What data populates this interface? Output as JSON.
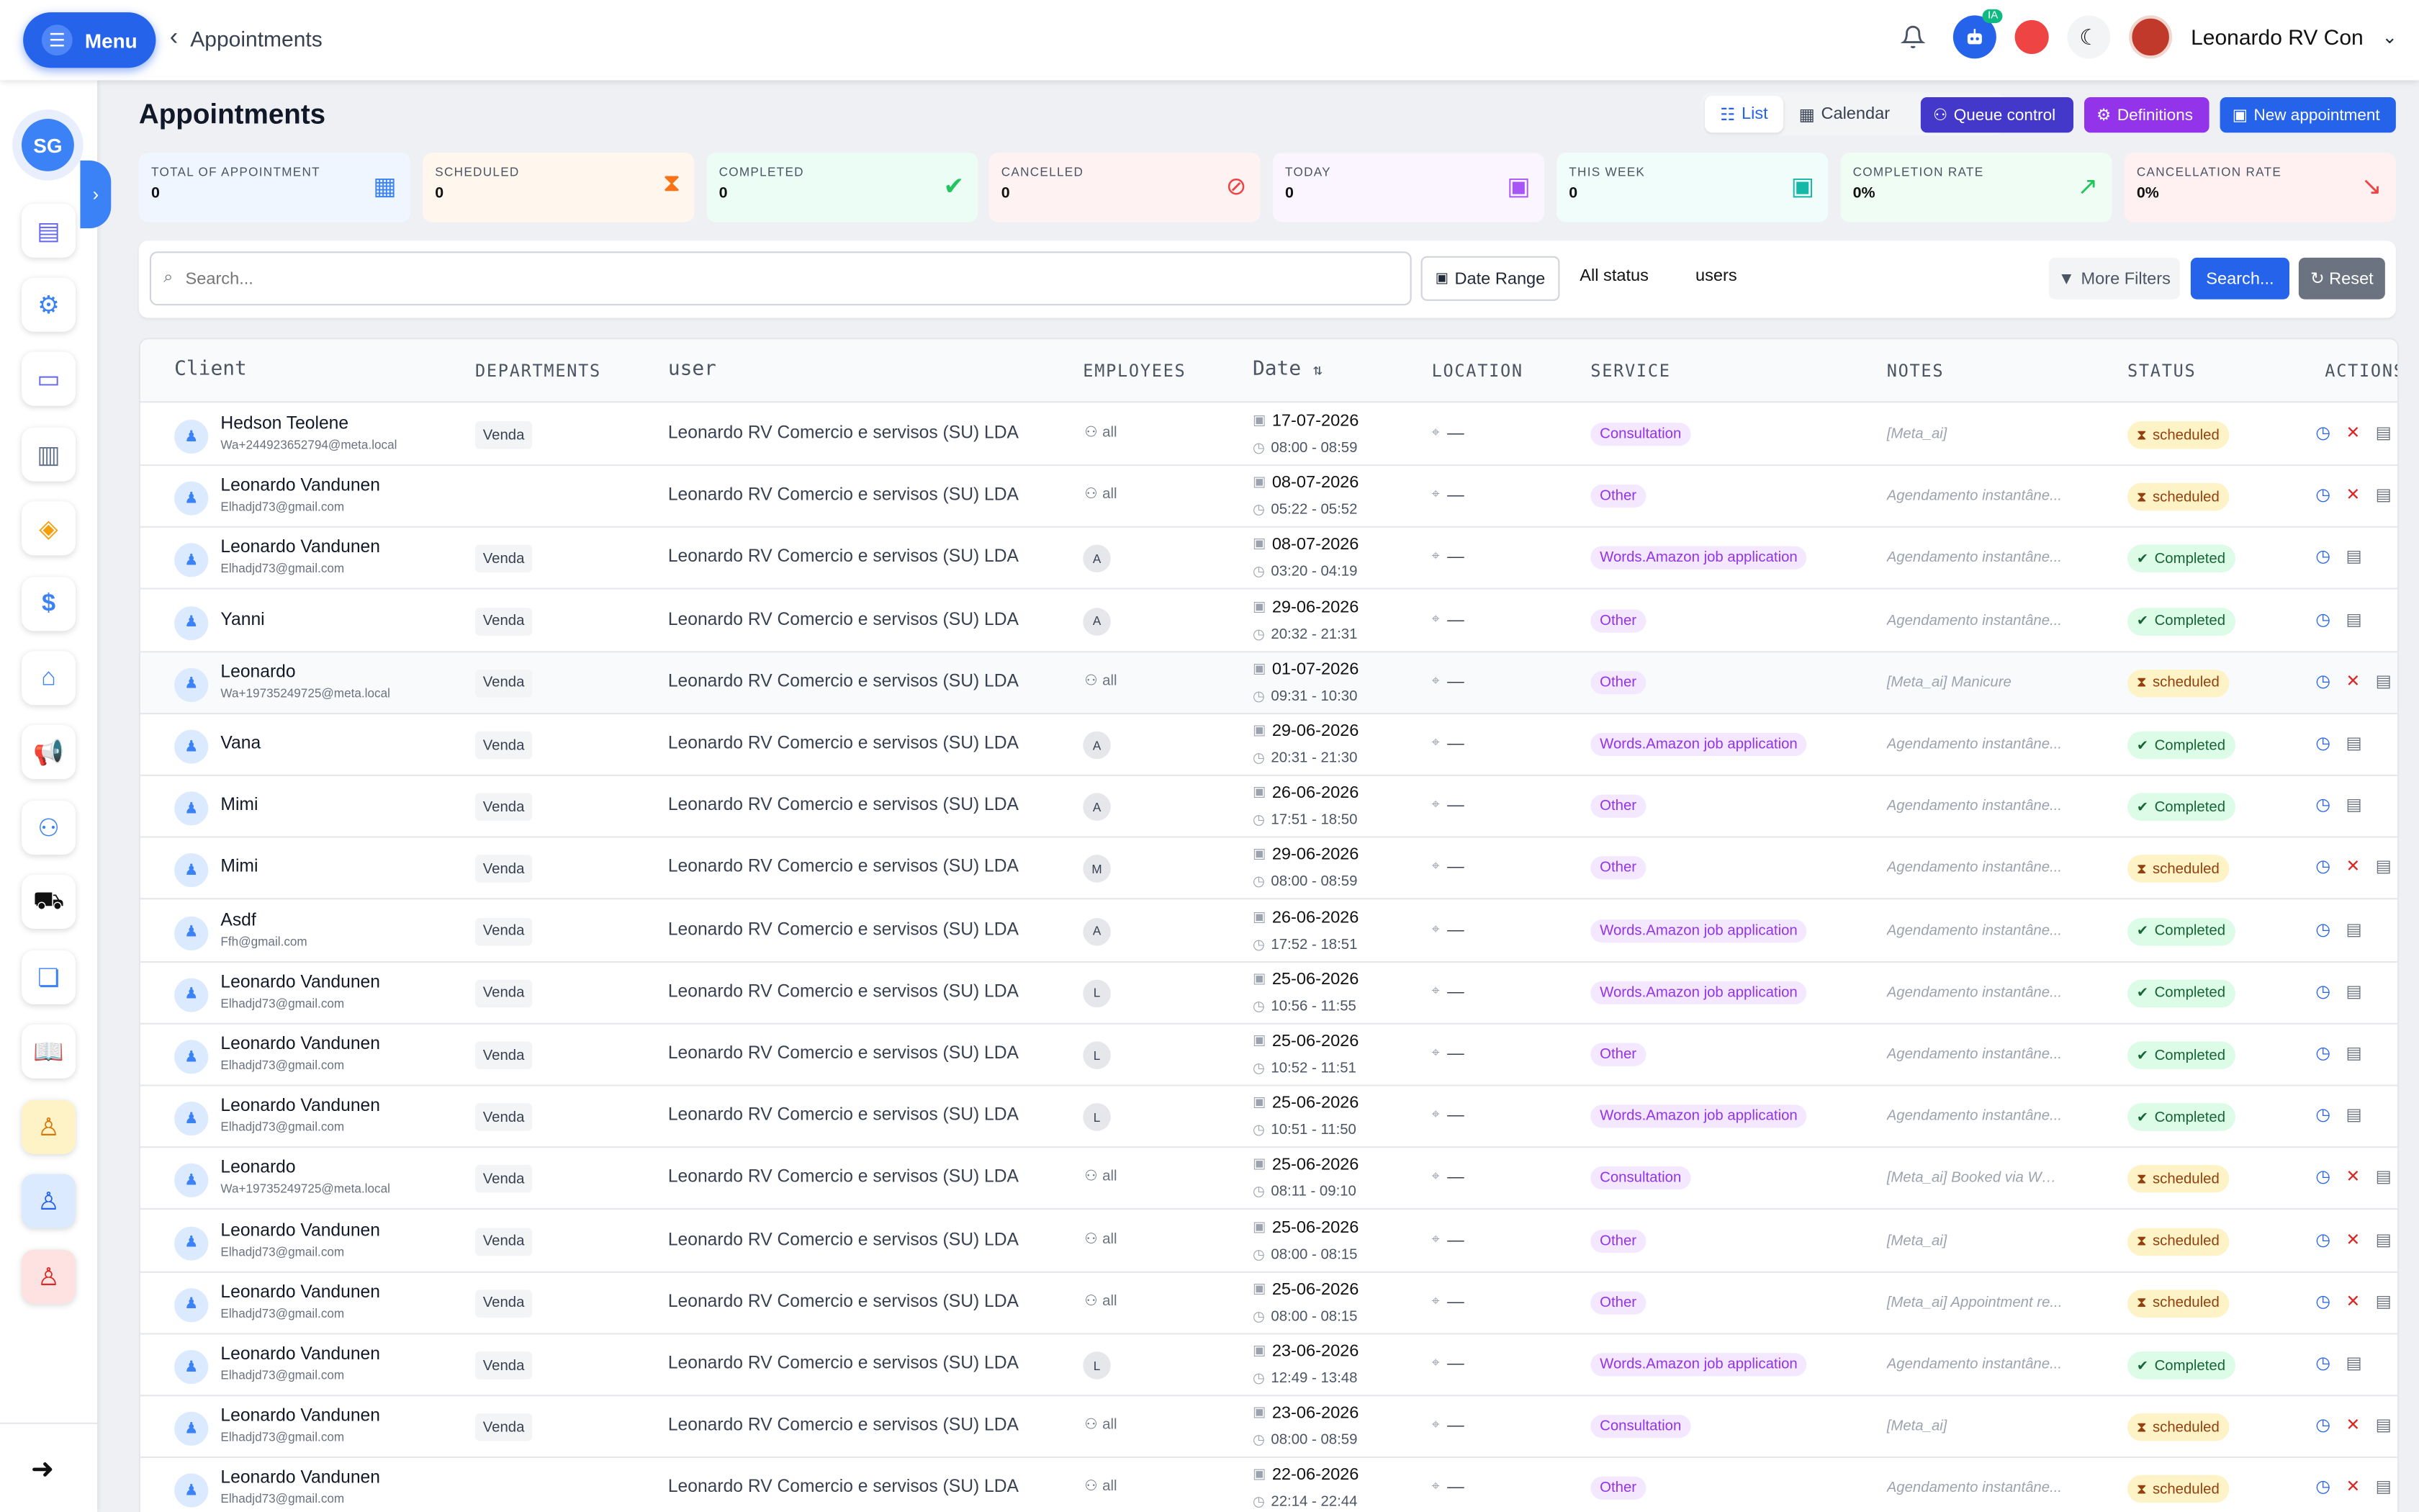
{
  "topbar": {
    "menu_label": "Menu",
    "breadcrumb": "Appointments",
    "ia_badge": "IA",
    "user_name": "Leonardo RV Con"
  },
  "sidebar": {
    "org_initials": "SG"
  },
  "page": {
    "title": "Appointments",
    "view_list": "List",
    "view_calendar": "Calendar",
    "btn_queue": "Queue control",
    "btn_definitions": "Definitions",
    "btn_new": "New appointment"
  },
  "stats": [
    {
      "label": "TOTAL OF APPOINTMENT",
      "value": "0"
    },
    {
      "label": "SCHEDULED",
      "value": "0"
    },
    {
      "label": "COMPLETED",
      "value": "0"
    },
    {
      "label": "CANCELLED",
      "value": "0"
    },
    {
      "label": "TODAY",
      "value": "0"
    },
    {
      "label": "THIS WEEK",
      "value": "0"
    },
    {
      "label": "COMPLETION RATE",
      "value": "0%"
    },
    {
      "label": "CANCELLATION RATE",
      "value": "0%"
    }
  ],
  "filters": {
    "search_placeholder": "Search...",
    "date_range": "Date Range",
    "status": "All status",
    "users": "users",
    "more_filters": "More Filters",
    "search_btn": "Search...",
    "reset_btn": "Reset"
  },
  "table": {
    "headers": [
      "Client",
      "DEPARTMENTS",
      "user",
      "EMPLOYEES",
      "Date",
      "LOCATION",
      "SERVICE",
      "NOTES",
      "STATUS",
      "ACTIONS"
    ],
    "rows": [
      {
        "name": "Hedson Teolene",
        "email": "Wa+244923652794@meta.local",
        "dept": "Venda",
        "user": "Leonardo RV Comercio e servisos (SU) LDA",
        "emp": "all",
        "date": "17-07-2026",
        "time": "08:00 - 08:59",
        "loc": "—",
        "service": "Consultation",
        "notes": "[Meta_ai]",
        "status": "scheduled"
      },
      {
        "name": "Leonardo Vandunen",
        "email": "Elhadjd73@gmail.com",
        "dept": "",
        "user": "Leonardo RV Comercio e servisos (SU) LDA",
        "emp": "all",
        "date": "08-07-2026",
        "time": "05:22 - 05:52",
        "loc": "—",
        "service": "Other",
        "notes": "Agendamento instantâne...",
        "status": "scheduled"
      },
      {
        "name": "Leonardo Vandunen",
        "email": "Elhadjd73@gmail.com",
        "dept": "Venda",
        "user": "Leonardo RV Comercio e servisos (SU) LDA",
        "emp": "A",
        "date": "08-07-2026",
        "time": "03:20 - 04:19",
        "loc": "—",
        "service": "Words.Amazon job application",
        "notes": "Agendamento instantâne...",
        "status": "Completed"
      },
      {
        "name": "Yanni",
        "email": "",
        "dept": "Venda",
        "user": "Leonardo RV Comercio e servisos (SU) LDA",
        "emp": "A",
        "date": "29-06-2026",
        "time": "20:32 - 21:31",
        "loc": "—",
        "service": "Other",
        "notes": "Agendamento instantâne...",
        "status": "Completed"
      },
      {
        "name": "Leonardo",
        "email": "Wa+19735249725@meta.local",
        "dept": "Venda",
        "user": "Leonardo RV Comercio e servisos (SU) LDA",
        "emp": "all",
        "date": "01-07-2026",
        "time": "09:31 - 10:30",
        "loc": "—",
        "service": "Other",
        "notes": "[Meta_ai] Manicure",
        "status": "scheduled"
      },
      {
        "name": "Vana",
        "email": "",
        "dept": "Venda",
        "user": "Leonardo RV Comercio e servisos (SU) LDA",
        "emp": "A",
        "date": "29-06-2026",
        "time": "20:31 - 21:30",
        "loc": "—",
        "service": "Words.Amazon job application",
        "notes": "Agendamento instantâne...",
        "status": "Completed"
      },
      {
        "name": "Mimi",
        "email": "",
        "dept": "Venda",
        "user": "Leonardo RV Comercio e servisos (SU) LDA",
        "emp": "A",
        "date": "26-06-2026",
        "time": "17:51 - 18:50",
        "loc": "—",
        "service": "Other",
        "notes": "Agendamento instantâne...",
        "status": "Completed"
      },
      {
        "name": "Mimi",
        "email": "",
        "dept": "Venda",
        "user": "Leonardo RV Comercio e servisos (SU) LDA",
        "emp": "M",
        "date": "29-06-2026",
        "time": "08:00 - 08:59",
        "loc": "—",
        "service": "Other",
        "notes": "Agendamento instantâne...",
        "status": "scheduled"
      },
      {
        "name": "Asdf",
        "email": "Ffh@gmail.com",
        "dept": "Venda",
        "user": "Leonardo RV Comercio e servisos (SU) LDA",
        "emp": "A",
        "date": "26-06-2026",
        "time": "17:52 - 18:51",
        "loc": "—",
        "service": "Words.Amazon job application",
        "notes": "Agendamento instantâne...",
        "status": "Completed"
      },
      {
        "name": "Leonardo Vandunen",
        "email": "Elhadjd73@gmail.com",
        "dept": "Venda",
        "user": "Leonardo RV Comercio e servisos (SU) LDA",
        "emp": "L",
        "date": "25-06-2026",
        "time": "10:56 - 11:55",
        "loc": "—",
        "service": "Words.Amazon job application",
        "notes": "Agendamento instantâne...",
        "status": "Completed"
      },
      {
        "name": "Leonardo Vandunen",
        "email": "Elhadjd73@gmail.com",
        "dept": "Venda",
        "user": "Leonardo RV Comercio e servisos (SU) LDA",
        "emp": "L",
        "date": "25-06-2026",
        "time": "10:52 - 11:51",
        "loc": "—",
        "service": "Other",
        "notes": "Agendamento instantâne...",
        "status": "Completed"
      },
      {
        "name": "Leonardo Vandunen",
        "email": "Elhadjd73@gmail.com",
        "dept": "Venda",
        "user": "Leonardo RV Comercio e servisos (SU) LDA",
        "emp": "L",
        "date": "25-06-2026",
        "time": "10:51 - 11:50",
        "loc": "—",
        "service": "Words.Amazon job application",
        "notes": "Agendamento instantâne...",
        "status": "Completed"
      },
      {
        "name": "Leonardo",
        "email": "Wa+19735249725@meta.local",
        "dept": "Venda",
        "user": "Leonardo RV Comercio e servisos (SU) LDA",
        "emp": "all",
        "date": "25-06-2026",
        "time": "08:11 - 09:10",
        "loc": "—",
        "service": "Consultation",
        "notes": "[Meta_ai] Booked via Wha...",
        "status": "scheduled"
      },
      {
        "name": "Leonardo Vandunen",
        "email": "Elhadjd73@gmail.com",
        "dept": "Venda",
        "user": "Leonardo RV Comercio e servisos (SU) LDA",
        "emp": "all",
        "date": "25-06-2026",
        "time": "08:00 - 08:15",
        "loc": "—",
        "service": "Other",
        "notes": "[Meta_ai]",
        "status": "scheduled"
      },
      {
        "name": "Leonardo Vandunen",
        "email": "Elhadjd73@gmail.com",
        "dept": "Venda",
        "user": "Leonardo RV Comercio e servisos (SU) LDA",
        "emp": "all",
        "date": "25-06-2026",
        "time": "08:00 - 08:15",
        "loc": "—",
        "service": "Other",
        "notes": "[Meta_ai] Appointment re...",
        "status": "scheduled"
      },
      {
        "name": "Leonardo Vandunen",
        "email": "Elhadjd73@gmail.com",
        "dept": "Venda",
        "user": "Leonardo RV Comercio e servisos (SU) LDA",
        "emp": "L",
        "date": "23-06-2026",
        "time": "12:49 - 13:48",
        "loc": "—",
        "service": "Words.Amazon job application",
        "notes": "Agendamento instantâne...",
        "status": "Completed"
      },
      {
        "name": "Leonardo Vandunen",
        "email": "Elhadjd73@gmail.com",
        "dept": "Venda",
        "user": "Leonardo RV Comercio e servisos (SU) LDA",
        "emp": "all",
        "date": "23-06-2026",
        "time": "08:00 - 08:59",
        "loc": "—",
        "service": "Consultation",
        "notes": "[Meta_ai]",
        "status": "scheduled"
      },
      {
        "name": "Leonardo Vandunen",
        "email": "Elhadjd73@gmail.com",
        "dept": "",
        "user": "Leonardo RV Comercio e servisos (SU) LDA",
        "emp": "all",
        "date": "22-06-2026",
        "time": "22:14 - 22:44",
        "loc": "—",
        "service": "Other",
        "notes": "Agendamento instantâne...",
        "status": "scheduled"
      }
    ]
  }
}
